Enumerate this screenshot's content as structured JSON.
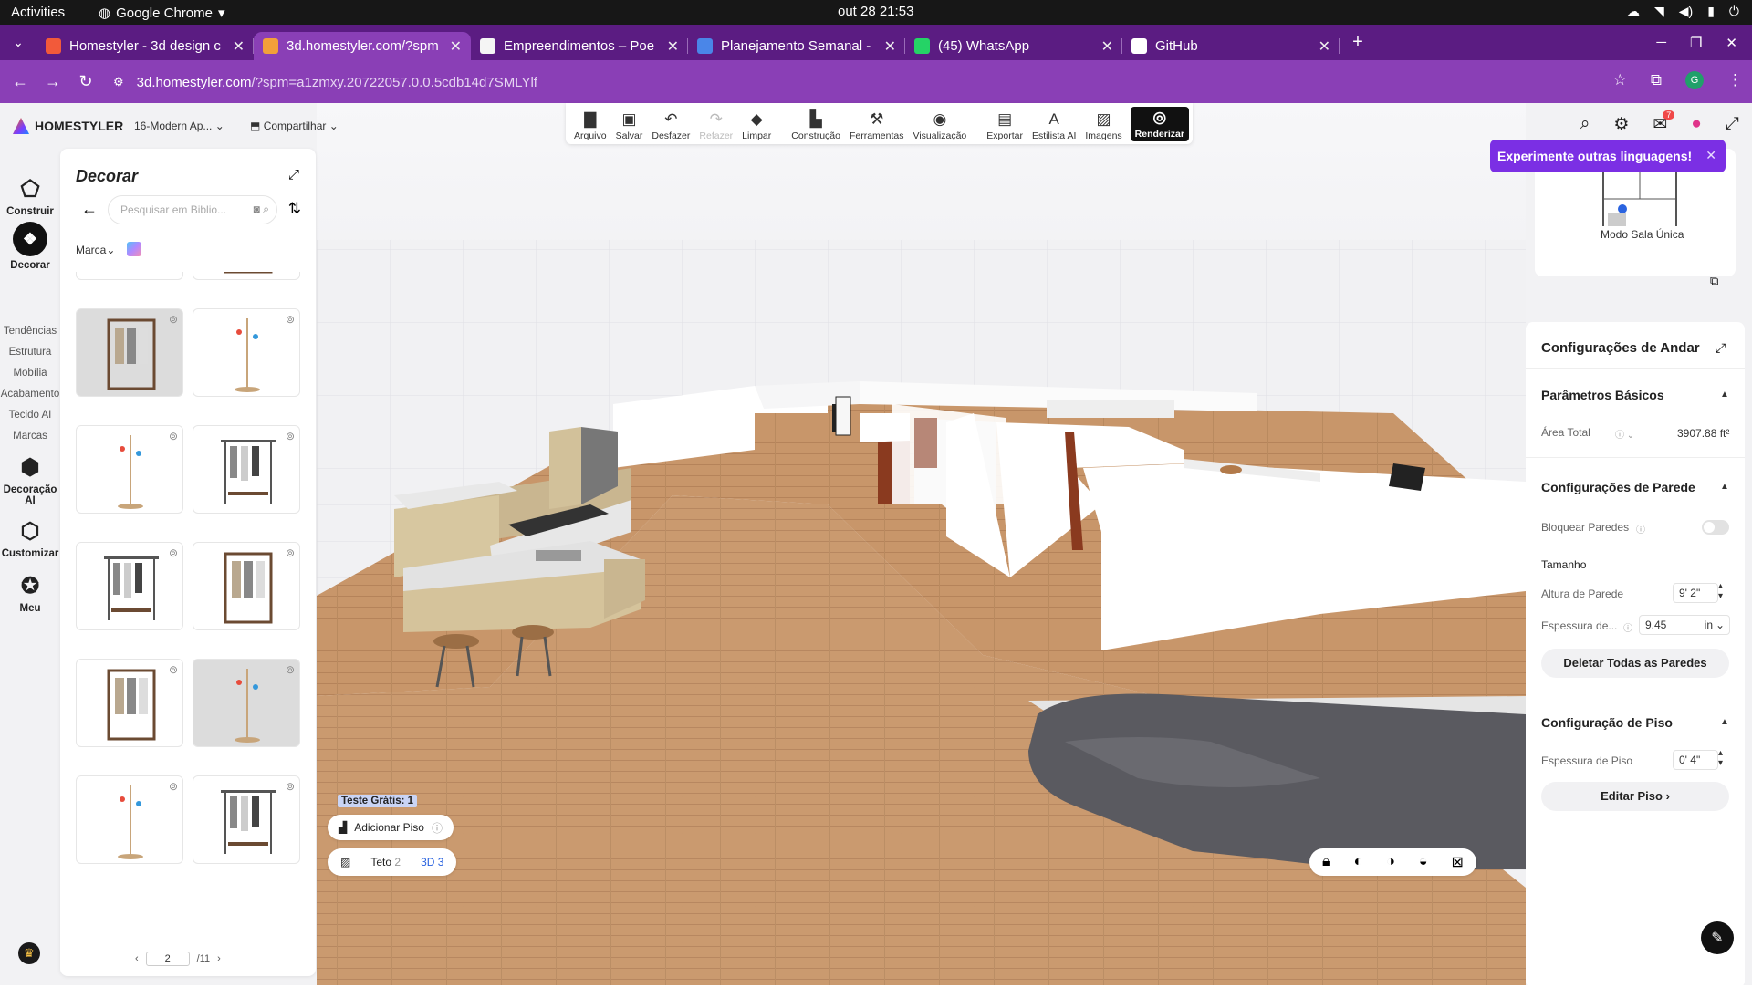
{
  "system": {
    "activities": "Activities",
    "browser": "Google Chrome",
    "clock": "out 28  21:53"
  },
  "tabs": [
    {
      "title": "Homestyler - 3d design c",
      "color": "#f25a3a",
      "active": false
    },
    {
      "title": "3d.homestyler.com/?spm",
      "color": "#f2a03a",
      "active": true
    },
    {
      "title": "Empreendimentos – Poe",
      "color": "#f5f5f5",
      "active": false
    },
    {
      "title": "Planejamento Semanal -",
      "color": "#4a86e8",
      "active": false
    },
    {
      "title": "(45) WhatsApp",
      "color": "#25d366",
      "active": false
    },
    {
      "title": "GitHub",
      "color": "#ffffff",
      "active": false
    }
  ],
  "address": {
    "host": "3d.homestyler.com",
    "path": "/?spm=a1zmxy.20722057.0.0.5cdb14d7SMLYlf",
    "avatar": "G"
  },
  "app": {
    "logo": "HOMESTYLER",
    "project": "16-Modern Ap...",
    "share": "Compartilhar",
    "toolbar": [
      {
        "label": "Arquivo",
        "icon": "folder-icon",
        "glyph": "▇",
        "enabled": true
      },
      {
        "label": "Salvar",
        "icon": "save-icon",
        "glyph": "▣",
        "enabled": true
      },
      {
        "label": "Desfazer",
        "icon": "undo-icon",
        "glyph": "↶",
        "enabled": true
      },
      {
        "label": "Refazer",
        "icon": "redo-icon",
        "glyph": "↷",
        "enabled": false
      },
      {
        "label": "Limpar",
        "icon": "eraser-icon",
        "glyph": "◆",
        "enabled": true
      },
      {
        "label": "Construção",
        "icon": "construction-icon",
        "glyph": "▙",
        "enabled": true
      },
      {
        "label": "Ferramentas",
        "icon": "tools-icon",
        "glyph": "⚒",
        "enabled": true
      },
      {
        "label": "Visualização",
        "icon": "eye-icon",
        "glyph": "◉",
        "enabled": true
      },
      {
        "label": "Exportar",
        "icon": "export-icon",
        "glyph": "▤",
        "enabled": true
      },
      {
        "label": "Estilista AI",
        "icon": "ai-stylist-icon",
        "glyph": "A",
        "enabled": true
      },
      {
        "label": "Imagens",
        "icon": "images-icon",
        "glyph": "▨",
        "enabled": true
      },
      {
        "label": "Renderizar",
        "icon": "render-icon",
        "glyph": "◎",
        "enabled": true
      }
    ],
    "notif_count": "7"
  },
  "leftnav": {
    "construir": "Construir",
    "decorar": "Decorar",
    "sublinks": [
      "Tendências",
      "Estrutura",
      "Mobília",
      "Acabamento",
      "Tecido AI",
      "Marcas"
    ],
    "decoracao_ai": "Decoração AI",
    "customizar": "Customizar",
    "meu": "Meu"
  },
  "catalog": {
    "title": "Decorar",
    "search_placeholder": "Pesquisar em Biblio...",
    "brand_filter": "Marca",
    "page": "2",
    "pages": "/11"
  },
  "rightpanel": {
    "tooltip": "Experimente outras linguagens!",
    "mode": "Modo Sala Única",
    "title": "Configurações de Andar",
    "basic_params": "Parâmetros Básicos",
    "area_label": "Área Total",
    "area_value": "3907.88 ft²",
    "wall_settings": "Configurações de Parede",
    "lock_walls": "Bloquear Paredes",
    "size": "Tamanho",
    "wall_height_label": "Altura de Parede",
    "wall_height": "9' 2\"",
    "wall_thickness_label": "Espessura de...",
    "wall_thickness": "9.45",
    "wall_thickness_unit": "in",
    "delete_walls": "Deletar Todas as Paredes",
    "floor_settings": "Configuração de Piso",
    "floor_thickness_label": "Espessura de Piso",
    "floor_thickness": "0' 4\"",
    "edit_floor": "Editar Piso ›"
  },
  "bottom": {
    "trial": "Teste Grátis: 1",
    "add_floor": "Adicionar Piso",
    "teto": "Teto",
    "teto_num": "2",
    "view3d": "3D",
    "view3d_num": "3"
  }
}
